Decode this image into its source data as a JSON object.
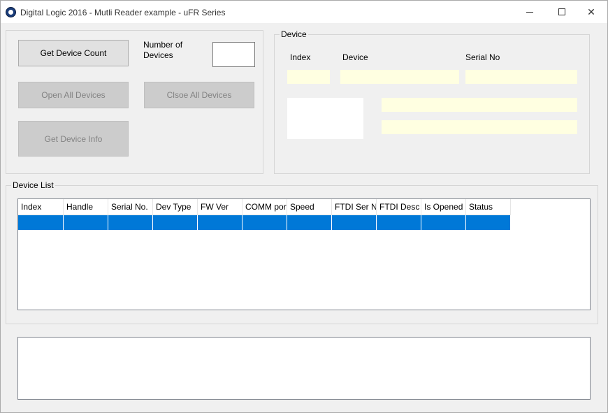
{
  "window": {
    "title": "Digital Logic 2016 - Mutli Reader example - uFR Series"
  },
  "buttons": {
    "get_device_count": "Get Device Count",
    "open_all_devices": "Open All Devices",
    "close_all_devices": "Clsoe All Devices",
    "get_device_info": "Get Device Info"
  },
  "number_of_devices": {
    "label_line1": "Number of",
    "label_line2": "Devices",
    "value": ""
  },
  "device_group": {
    "legend": "Device",
    "index_label": "Index",
    "device_label": "Device",
    "serial_label": "Serial No"
  },
  "device_list": {
    "legend": "Device List",
    "columns": [
      "Index",
      "Handle",
      "Serial No.",
      "Dev Type",
      "FW Ver",
      "COMM port",
      "Speed",
      "FTDI Ser No",
      "FTDI Desc",
      "Is Opened",
      "Status"
    ]
  }
}
